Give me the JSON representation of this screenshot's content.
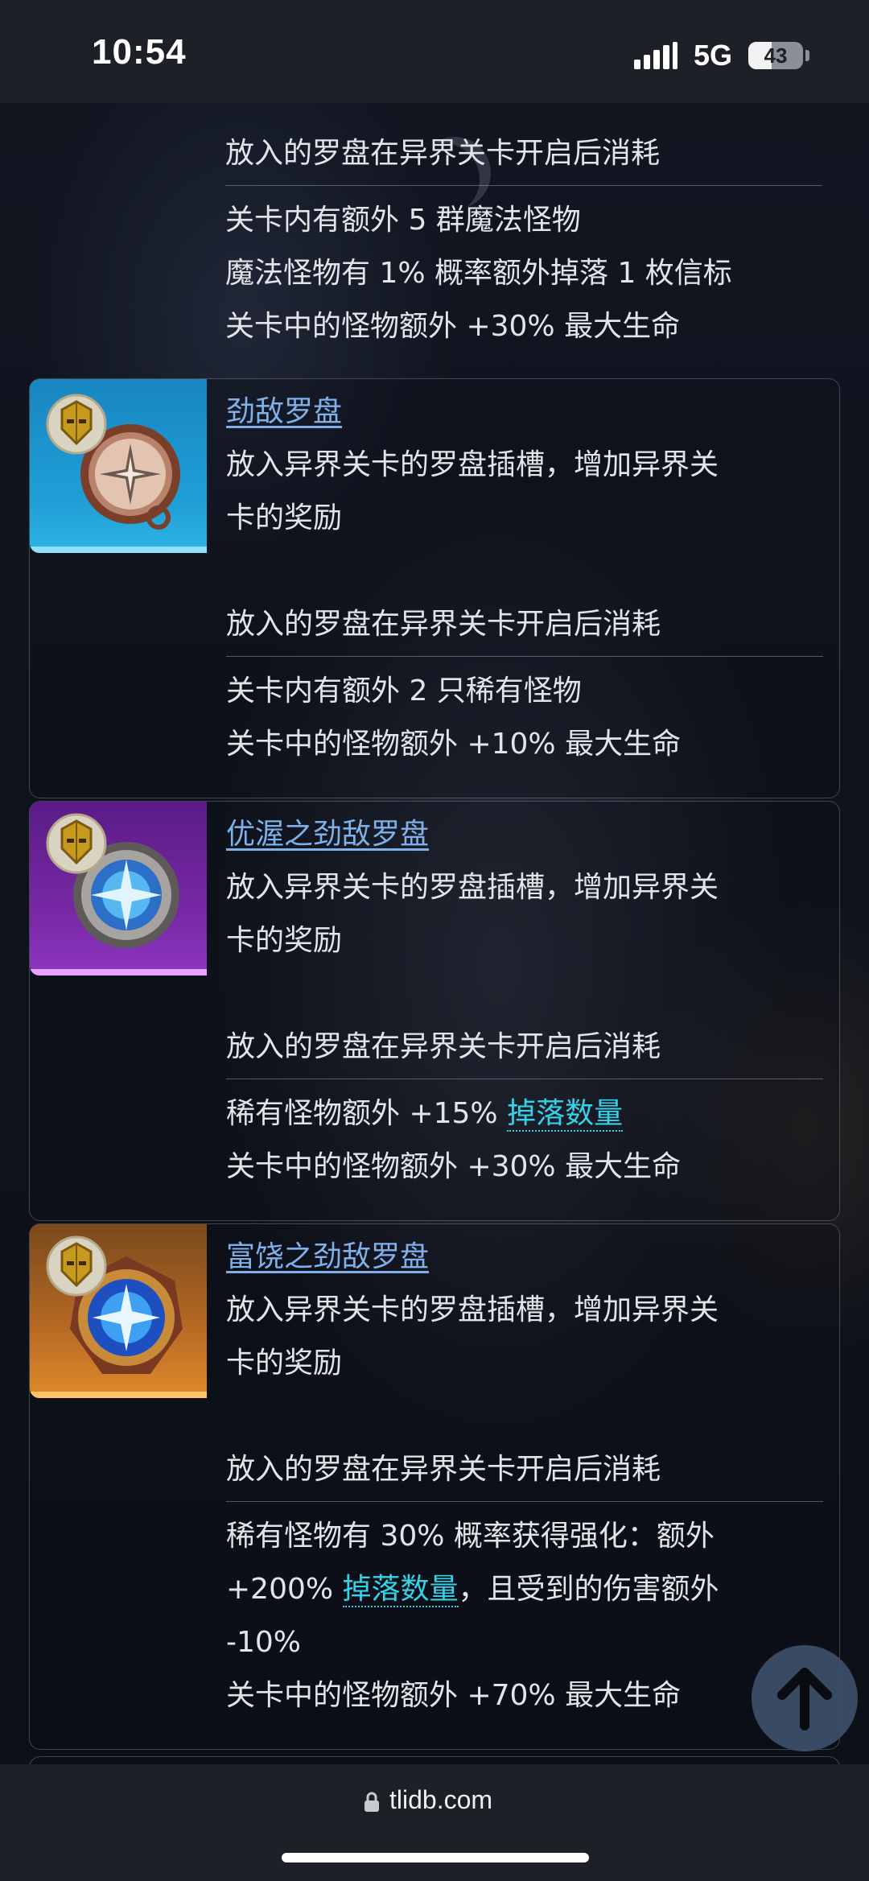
{
  "status_bar": {
    "time": "10:54",
    "network": "5G",
    "battery": "43",
    "battery_level": 0.43
  },
  "partial_card": {
    "consume_line": "放入的罗盘在异界关卡开启后消耗",
    "effects": [
      "关卡内有额外 5 群魔法怪物",
      "魔法怪物有 1% 概率额外掉落 1 枚信标",
      "关卡中的怪物额外 +30% 最大生命"
    ]
  },
  "cards": [
    {
      "title": "劲敌罗盘",
      "thumb_color": "#1f9fd6",
      "desc": [
        "放入异界关卡的罗盘插槽，增加异界关",
        "卡的奖励"
      ],
      "consume_line": "放入的罗盘在异界关卡开启后消耗",
      "effects": [
        {
          "text": "关卡内有额外 2 只稀有怪物"
        },
        {
          "text": "关卡中的怪物额外 +10% 最大生命"
        }
      ]
    },
    {
      "title": "优渥之劲敌罗盘",
      "thumb_color": "#7a2aa8",
      "desc": [
        "放入异界关卡的罗盘插槽，增加异界关",
        "卡的奖励"
      ],
      "consume_line": "放入的罗盘在异界关卡开启后消耗",
      "effects": [
        {
          "pre": "稀有怪物额外 +15% ",
          "keyword": "掉落数量",
          "post": ""
        },
        {
          "text": "关卡中的怪物额外 +30% 最大生命"
        }
      ]
    },
    {
      "title": "富饶之劲敌罗盘",
      "thumb_color": "#e08a2c",
      "desc": [
        "放入异界关卡的罗盘插槽，增加异界关",
        "卡的奖励"
      ],
      "consume_line": "放入的罗盘在异界关卡开启后消耗",
      "effects": [
        {
          "text": "稀有怪物有 30% 概率获得强化：额外"
        },
        {
          "pre": "+200% ",
          "keyword": "掉落数量",
          "post": "，且受到的伤害额外"
        },
        {
          "text": "-10%"
        },
        {
          "text": "关卡中的怪物额外 +70% 最大生命"
        }
      ]
    }
  ],
  "icons": {
    "compass": "compass-icon",
    "mask_badge": "golden-mask-icon",
    "scroll_top": "arrow-up-icon",
    "lock": "lock-icon"
  },
  "browser": {
    "url": "tlidb.com"
  }
}
